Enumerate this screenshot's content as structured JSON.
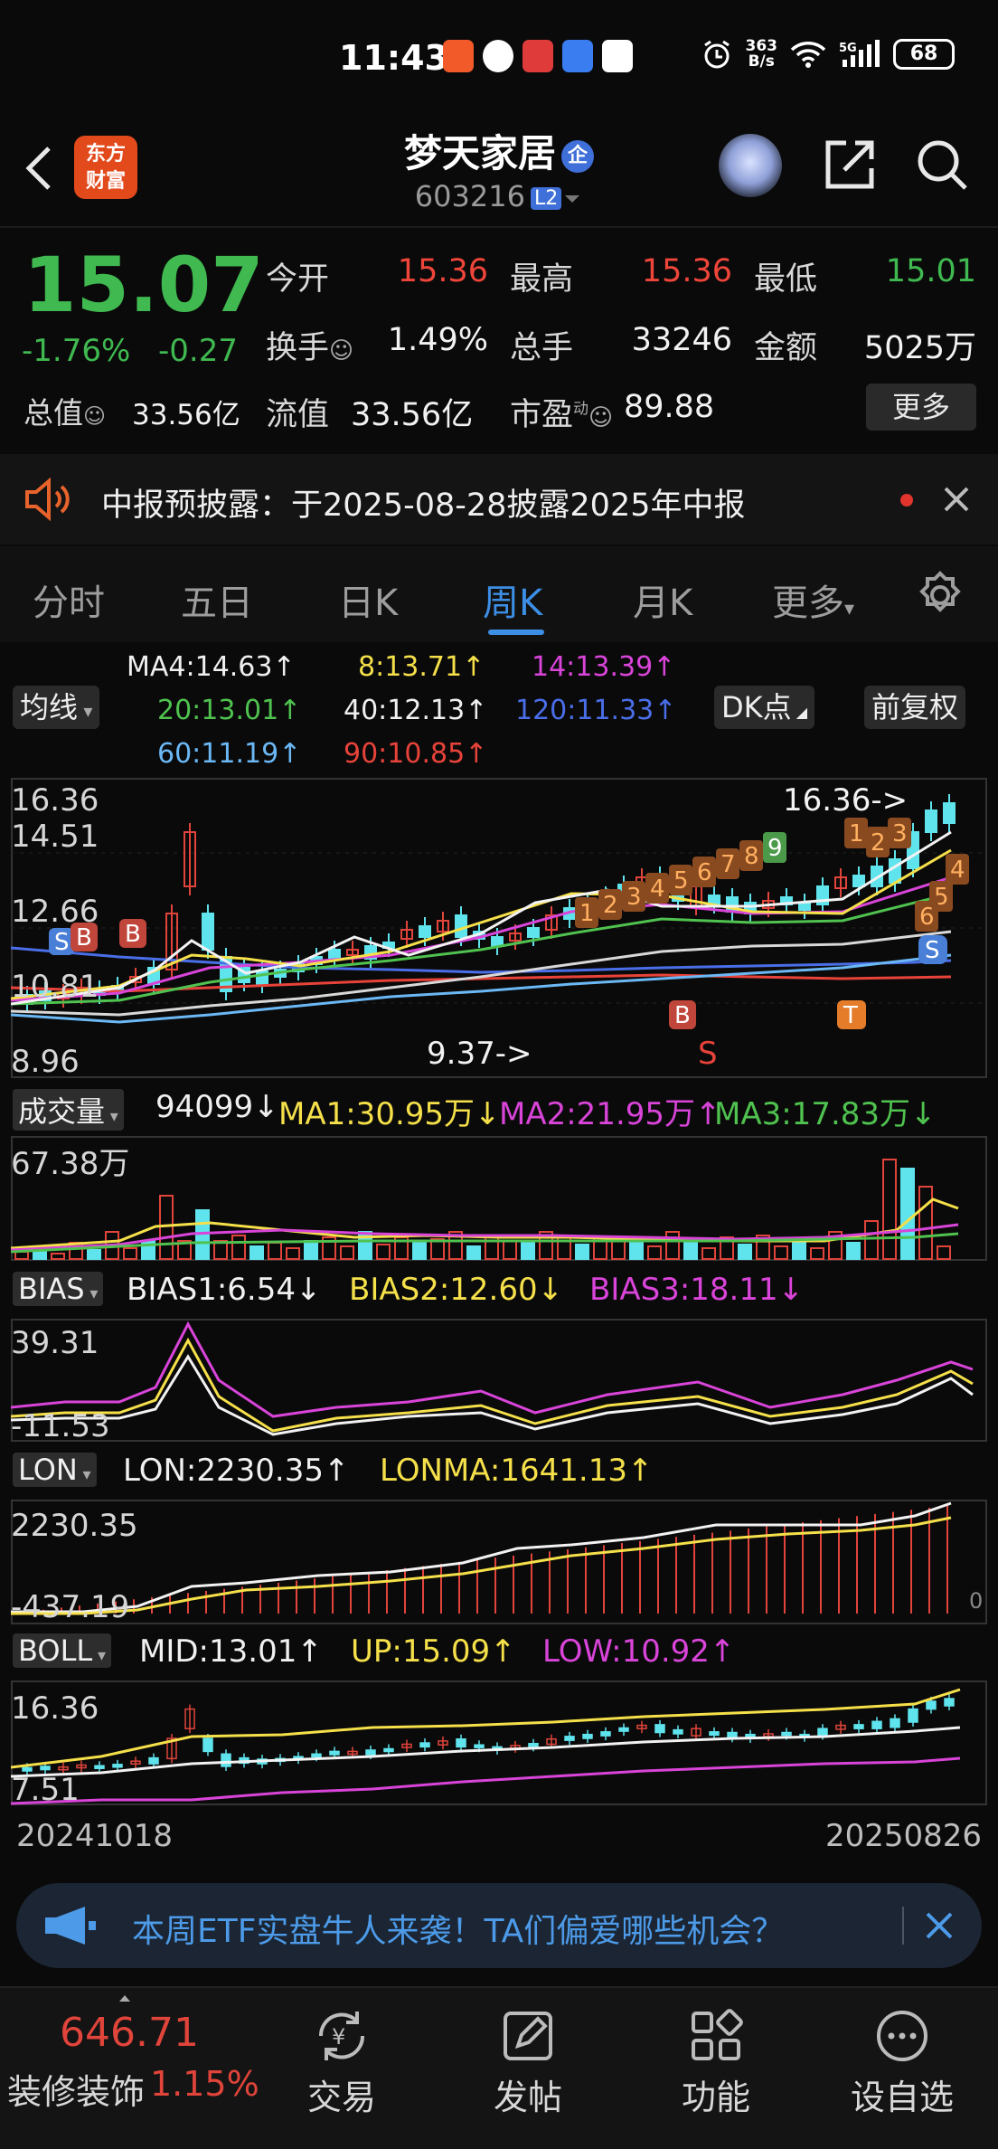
{
  "status": {
    "time": "11:43",
    "net_speed_value": "363",
    "net_speed_unit": "B/s",
    "battery": "68"
  },
  "header": {
    "title": "梦天家居",
    "corp_badge": "企",
    "logo_line1": "东方",
    "logo_line2": "财富",
    "code": "603216",
    "level": "L2"
  },
  "quote": {
    "price": "15.07",
    "change_pct": "-1.76%",
    "change": "-0.27",
    "stats_row1": [
      {
        "label": "今开",
        "value": "15.36"
      },
      {
        "label": "最高",
        "value": "15.36"
      },
      {
        "label": "最低",
        "value": "15.01"
      }
    ],
    "stats_row2": [
      {
        "label": "换手",
        "value": "1.49%"
      },
      {
        "label": "总手",
        "value": "33246"
      },
      {
        "label": "金额",
        "value": "5025万"
      }
    ],
    "stats_row3": [
      {
        "label": "总值",
        "value": "33.56亿"
      },
      {
        "label": "流值",
        "value": "33.56亿"
      },
      {
        "label": "市盈",
        "sup": "动",
        "value": "89.88"
      }
    ],
    "more_button": "更多"
  },
  "notice": {
    "text": "中报预披露：于2025-08-28披露2025年中报"
  },
  "tabs": [
    "分时",
    "五日",
    "日K",
    "周K",
    "月K",
    "更多"
  ],
  "ma_panel": {
    "ma_button": "均线",
    "dk_button": "DK点",
    "fq_button": "前复权",
    "row1": [
      "MA4:14.63↑",
      "8:13.71↑",
      "14:13.39↑"
    ],
    "row2": [
      "20:13.01↑",
      "40:12.13↑",
      "120:11.33↑"
    ],
    "row3": [
      "60:11.19↑",
      "90:10.85↑"
    ]
  },
  "kline": {
    "y_labels": [
      "16.36",
      "14.51",
      "12.66",
      "10.81",
      "8.96"
    ],
    "high_label": "16.36->",
    "low_label": "9.37->",
    "td_counts_a": [
      "1",
      "2",
      "3",
      "4",
      "5",
      "6",
      "7",
      "8",
      "9"
    ],
    "td_counts_b": [
      "1",
      "2",
      "3",
      "4",
      "5",
      "6"
    ],
    "markers": {
      "s": "S",
      "b": "B",
      "t": "T"
    }
  },
  "volume": {
    "indicator": "成交量",
    "items": [
      "94099↓",
      "MA1:30.95万↓",
      "MA2:21.95万↑",
      "MA3:17.83万↓"
    ],
    "max_label": "67.38万"
  },
  "bias": {
    "indicator": "BIAS",
    "items": [
      "BIAS1:6.54↓",
      "BIAS2:12.60↓",
      "BIAS3:18.11↓"
    ],
    "y_top": "39.31",
    "y_bottom": "-11.53"
  },
  "lon": {
    "indicator": "LON",
    "items": [
      "LON:2230.35↑",
      "LONMA:1641.13↑"
    ],
    "y_top": "2230.35",
    "y_bottom": "-437.19",
    "zero_label": "0"
  },
  "boll": {
    "indicator": "BOLL",
    "items": [
      "MID:13.01↑",
      "UP:15.09↑",
      "LOW:10.92↑"
    ],
    "y_top": "16.36",
    "y_bottom": "7.51"
  },
  "dates": {
    "start": "20241018",
    "end": "20250826"
  },
  "banner": {
    "text": "本周ETF实盘牛人来袭！TA们偏爱哪些机会？"
  },
  "bottom_nav": {
    "index_value": "646.71",
    "index_name": "装修装饰",
    "index_change": "1.15%",
    "items": [
      "交易",
      "发帖",
      "功能",
      "设自选"
    ]
  }
}
